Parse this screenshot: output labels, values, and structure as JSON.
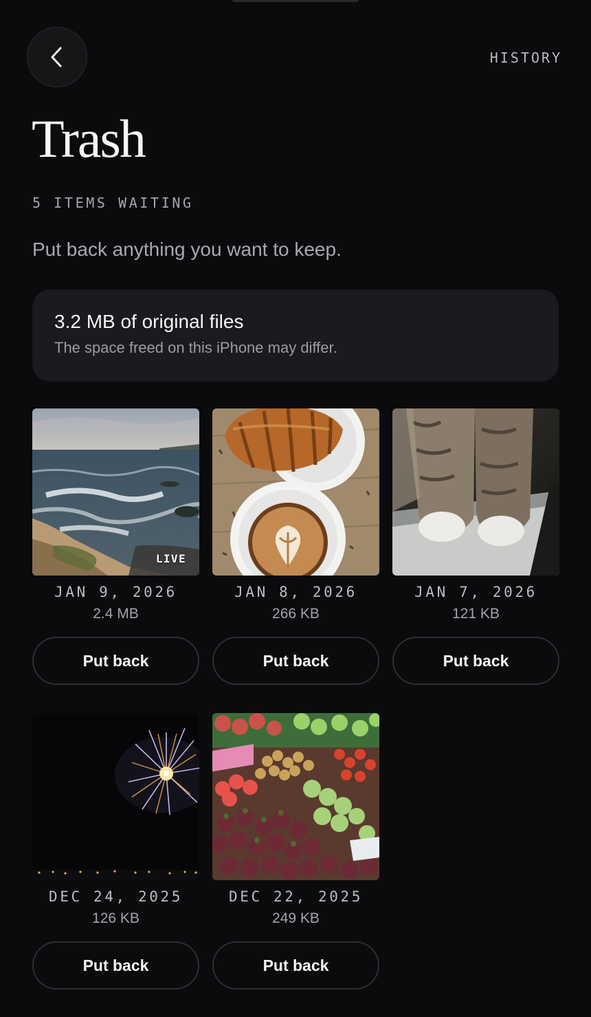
{
  "header": {
    "back_icon": "chevron-left-icon",
    "history_label": "HISTORY"
  },
  "page": {
    "title": "Trash",
    "count_label": "5 ITEMS WAITING",
    "subtitle": "Put back anything you want to keep."
  },
  "storage_card": {
    "headline": "3.2 MB of original files",
    "note": "The space freed on this iPhone may differ."
  },
  "items": [
    {
      "thumbnail": "ocean-waves",
      "badge": "LIVE",
      "date": "JAN 9, 2026",
      "size": "2.4 MB",
      "action_label": "Put back"
    },
    {
      "thumbnail": "croissant-coffee",
      "badge": "",
      "date": "JAN 8, 2026",
      "size": "266 KB",
      "action_label": "Put back"
    },
    {
      "thumbnail": "cat-paws",
      "badge": "",
      "date": "JAN 7, 2026",
      "size": "121 KB",
      "action_label": "Put back"
    },
    {
      "thumbnail": "fireworks",
      "badge": "",
      "date": "DEC 24, 2025",
      "size": "126 KB",
      "action_label": "Put back"
    },
    {
      "thumbnail": "fruit-market",
      "badge": "",
      "date": "DEC 22, 2025",
      "size": "249 KB",
      "action_label": "Put back"
    }
  ],
  "colors": {
    "background": "#0b0b0d",
    "card": "#1a1b1e",
    "button_border": "#2e2e32"
  }
}
